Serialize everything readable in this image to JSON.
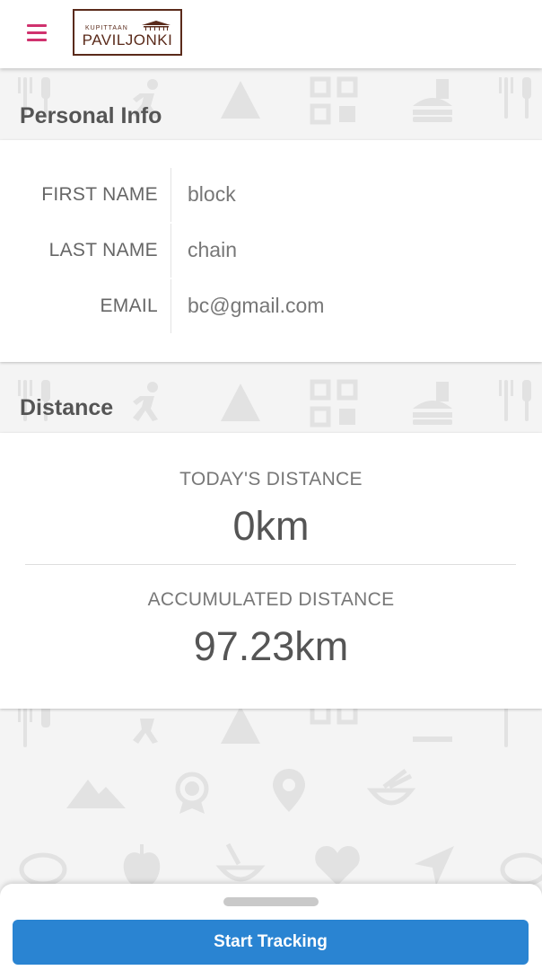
{
  "header": {
    "menu_icon": "hamburger-menu-icon",
    "logo": {
      "top_text": "KUPITTAAN",
      "main_text": "PAVILJONKI"
    }
  },
  "personal_info": {
    "heading": "Personal Info",
    "fields": [
      {
        "label": "FIRST NAME",
        "value": "block"
      },
      {
        "label": "LAST NAME",
        "value": "chain"
      },
      {
        "label": "EMAIL",
        "value": "bc@gmail.com"
      }
    ]
  },
  "distance": {
    "heading": "Distance",
    "today_label": "TODAY'S DISTANCE",
    "today_value": "0km",
    "accumulated_label": "ACCUMULATED DISTANCE",
    "accumulated_value": "97.23km"
  },
  "bottom_sheet": {
    "start_button_label": "Start Tracking"
  },
  "colors": {
    "accent": "#d0326e",
    "brand": "#5a2a1a",
    "button": "#2a84d2"
  }
}
